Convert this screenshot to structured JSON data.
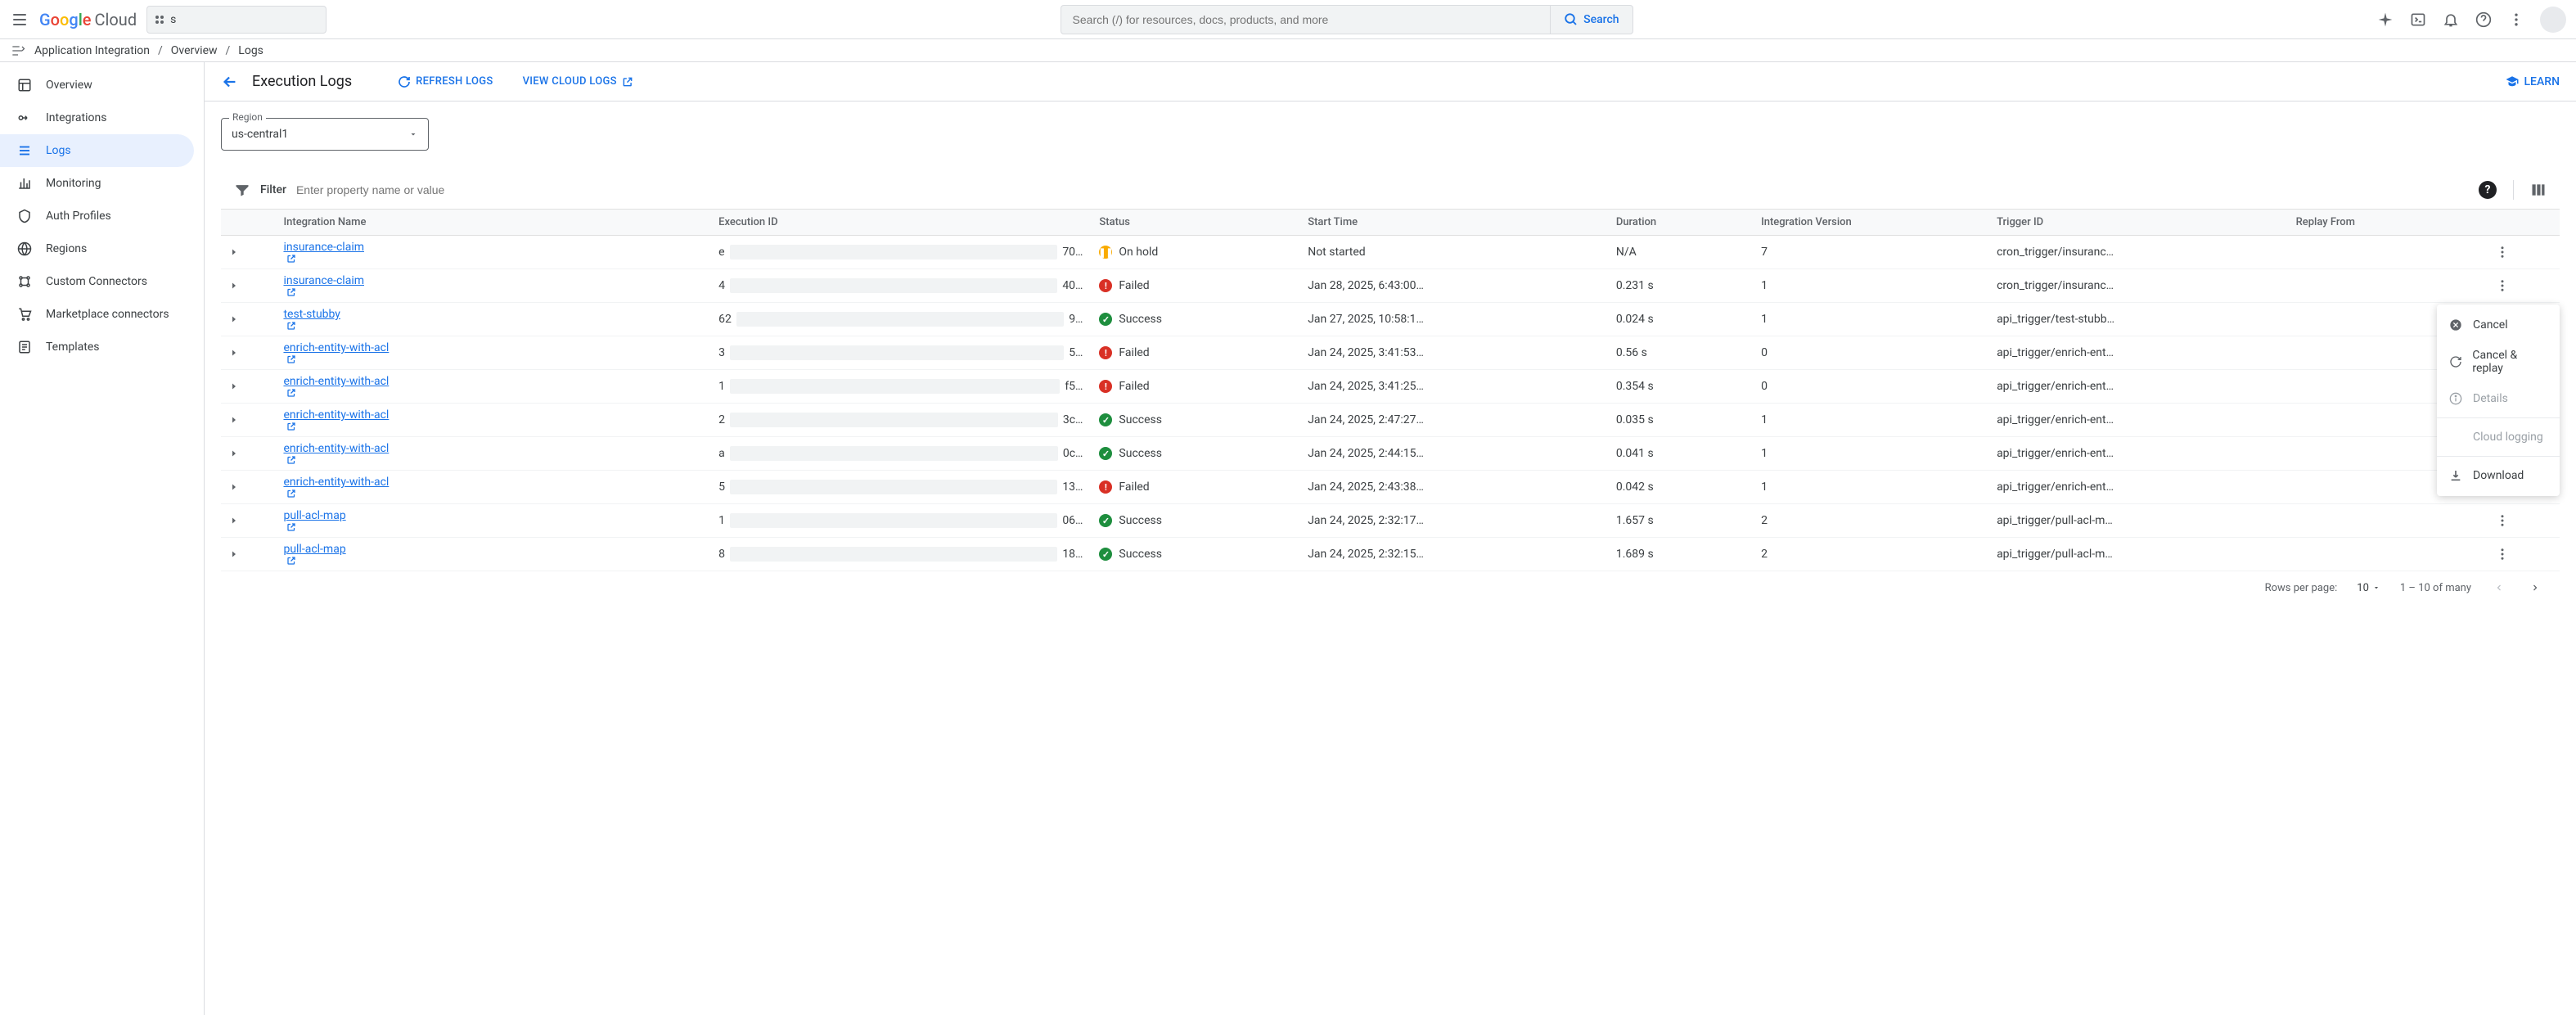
{
  "topbar": {
    "logo_google": "Google",
    "logo_cloud": "Cloud",
    "project_text": "s",
    "search_placeholder": "Search (/) for resources, docs, products, and more",
    "search_button": "Search"
  },
  "breadcrumb": {
    "product": "Application Integration",
    "crumb1": "Overview",
    "crumb2": "Logs"
  },
  "sidebar": {
    "items": [
      {
        "label": "Overview"
      },
      {
        "label": "Integrations"
      },
      {
        "label": "Logs"
      },
      {
        "label": "Monitoring"
      },
      {
        "label": "Auth Profiles"
      },
      {
        "label": "Regions"
      },
      {
        "label": "Custom Connectors"
      },
      {
        "label": "Marketplace connectors"
      },
      {
        "label": "Templates"
      }
    ]
  },
  "header": {
    "title": "Execution Logs",
    "refresh": "Refresh Logs",
    "view_cloud_logs": "View Cloud Logs",
    "learn": "LEARN"
  },
  "region": {
    "label": "Region",
    "value": "us-central1"
  },
  "filter": {
    "label": "Filter",
    "placeholder": "Enter property name or value"
  },
  "columns": {
    "name": "Integration Name",
    "exec": "Execution ID",
    "status": "Status",
    "start": "Start Time",
    "dur": "Duration",
    "ver": "Integration Version",
    "trig": "Trigger ID",
    "replay": "Replay From"
  },
  "status_labels": {
    "hold": "On hold",
    "failed": "Failed",
    "success": "Success"
  },
  "rows": [
    {
      "name": "insurance-claim",
      "exec_pre": "e",
      "exec_post": "70…",
      "status": "hold",
      "start": "Not started",
      "dur": "N/A",
      "ver": "7",
      "trig": "cron_trigger/insuranc…",
      "replay": ""
    },
    {
      "name": "insurance-claim",
      "exec_pre": "4",
      "exec_post": "40…",
      "status": "failed",
      "start": "Jan 28, 2025, 6:43:00…",
      "dur": "0.231 s",
      "ver": "1",
      "trig": "cron_trigger/insuranc…",
      "replay": ""
    },
    {
      "name": "test-stubby",
      "exec_pre": "62",
      "exec_post": "9…",
      "status": "success",
      "start": "Jan 27, 2025, 10:58:1…",
      "dur": "0.024 s",
      "ver": "1",
      "trig": "api_trigger/test-stubb…",
      "replay": ""
    },
    {
      "name": "enrich-entity-with-acl",
      "exec_pre": "3",
      "exec_post": "5…",
      "status": "failed",
      "start": "Jan 24, 2025, 3:41:53…",
      "dur": "0.56 s",
      "ver": "0",
      "trig": "api_trigger/enrich-ent…",
      "replay": ""
    },
    {
      "name": "enrich-entity-with-acl",
      "exec_pre": "1",
      "exec_post": "f5…",
      "status": "failed",
      "start": "Jan 24, 2025, 3:41:25…",
      "dur": "0.354 s",
      "ver": "0",
      "trig": "api_trigger/enrich-ent…",
      "replay": ""
    },
    {
      "name": "enrich-entity-with-acl",
      "exec_pre": "2",
      "exec_post": "3c…",
      "status": "success",
      "start": "Jan 24, 2025, 2:47:27…",
      "dur": "0.035 s",
      "ver": "1",
      "trig": "api_trigger/enrich-ent…",
      "replay": ""
    },
    {
      "name": "enrich-entity-with-acl",
      "exec_pre": "a",
      "exec_post": "0c…",
      "status": "success",
      "start": "Jan 24, 2025, 2:44:15…",
      "dur": "0.041 s",
      "ver": "1",
      "trig": "api_trigger/enrich-ent…",
      "replay": ""
    },
    {
      "name": "enrich-entity-with-acl",
      "exec_pre": "5",
      "exec_post": "13…",
      "status": "failed",
      "start": "Jan 24, 2025, 2:43:38…",
      "dur": "0.042 s",
      "ver": "1",
      "trig": "api_trigger/enrich-ent…",
      "replay": ""
    },
    {
      "name": "pull-acl-map",
      "exec_pre": "1",
      "exec_post": "06…",
      "status": "success",
      "start": "Jan 24, 2025, 2:32:17…",
      "dur": "1.657 s",
      "ver": "2",
      "trig": "api_trigger/pull-acl-m…",
      "replay": ""
    },
    {
      "name": "pull-acl-map",
      "exec_pre": "8",
      "exec_post": "18…",
      "status": "success",
      "start": "Jan 24, 2025, 2:32:15…",
      "dur": "1.689 s",
      "ver": "2",
      "trig": "api_trigger/pull-acl-m…",
      "replay": ""
    }
  ],
  "pagination": {
    "rows_label": "Rows per page:",
    "rows_value": "10",
    "range": "1 – 10 of many"
  },
  "context_menu": {
    "cancel": "Cancel",
    "cancel_replay": "Cancel & replay",
    "details": "Details",
    "cloud_logging": "Cloud logging",
    "download": "Download"
  }
}
